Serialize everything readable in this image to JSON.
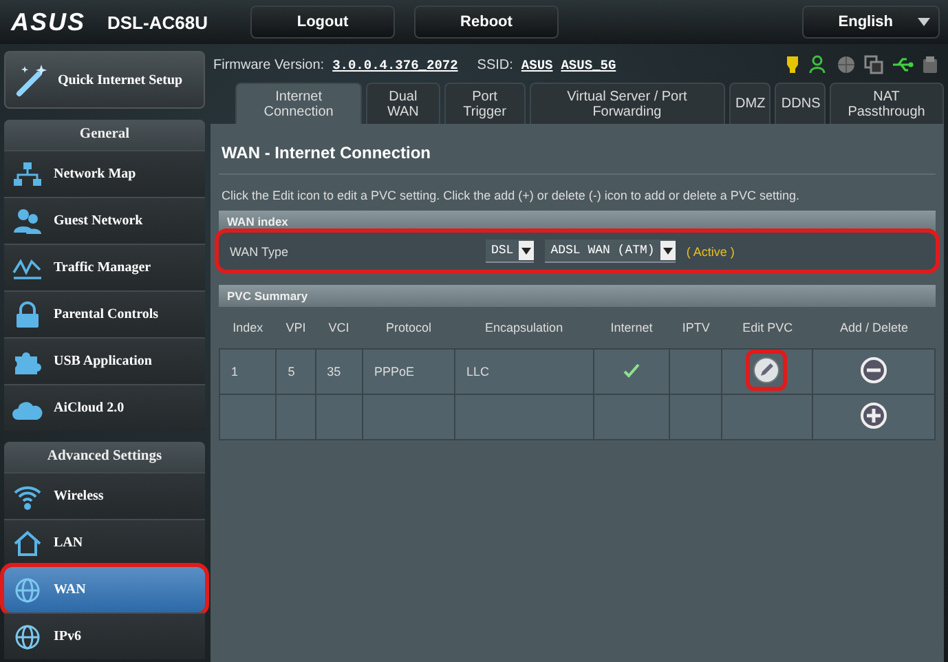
{
  "header": {
    "logo": "ASUS",
    "model": "DSL-AC68U",
    "buttons": [
      "Logout",
      "Reboot"
    ],
    "language": "English"
  },
  "quick_setup": {
    "label": "Quick Internet Setup"
  },
  "sidebar": [
    {
      "title": "General",
      "items": [
        {
          "label": "Network Map",
          "kind": "network",
          "selected": false,
          "highlighted": false
        },
        {
          "label": "Guest Network",
          "kind": "guests",
          "selected": false,
          "highlighted": false
        },
        {
          "label": "Traffic Manager",
          "kind": "traffic",
          "selected": false,
          "highlighted": false
        },
        {
          "label": "Parental Controls",
          "kind": "lock",
          "selected": false,
          "highlighted": false
        },
        {
          "label": "USB Application",
          "kind": "puzzle",
          "selected": false,
          "highlighted": false
        },
        {
          "label": "AiCloud 2.0",
          "kind": "cloud",
          "selected": false,
          "highlighted": false
        }
      ]
    },
    {
      "title": "Advanced Settings",
      "items": [
        {
          "label": "Wireless",
          "kind": "wifi",
          "selected": false,
          "highlighted": false
        },
        {
          "label": "LAN",
          "kind": "home",
          "selected": false,
          "highlighted": false
        },
        {
          "label": "WAN",
          "kind": "globe",
          "selected": true,
          "highlighted": true
        },
        {
          "label": "IPv6",
          "kind": "globe",
          "selected": false,
          "highlighted": false
        }
      ]
    }
  ],
  "info": {
    "firmware_label": "Firmware Version:",
    "firmware": "3.0.0.4.376_2072",
    "ssid_label": "SSID:",
    "ssids": [
      "ASUS",
      "ASUS_5G"
    ]
  },
  "tabs": [
    {
      "label": "Internet Connection",
      "selected": true
    },
    {
      "label": "Dual WAN",
      "selected": false
    },
    {
      "label": "Port Trigger",
      "selected": false
    },
    {
      "label": "Virtual Server / Port Forwarding",
      "selected": false
    },
    {
      "label": "DMZ",
      "selected": false
    },
    {
      "label": "DDNS",
      "selected": false
    },
    {
      "label": "NAT Passthrough",
      "selected": false
    }
  ],
  "page": {
    "title": "WAN - Internet Connection",
    "description": "Click the Edit icon to edit a PVC setting. Click the add (+) or delete (-) icon to add or delete a PVC setting.",
    "wan_index": {
      "header": "WAN index",
      "label": "WAN Type",
      "selects": [
        "DSL",
        "ADSL WAN (ATM)"
      ],
      "status": "( Active )",
      "highlighted": true
    },
    "pvc": {
      "header": "PVC Summary",
      "columns": [
        "Index",
        "VPI",
        "VCI",
        "Protocol",
        "Encapsulation",
        "Internet",
        "IPTV",
        "Edit PVC",
        "Add / Delete"
      ],
      "rows": [
        {
          "kind": "pvc",
          "cells": [
            "1",
            "5",
            "35",
            "PPPoE",
            "LLC"
          ],
          "internet": true,
          "iptv": false,
          "edit_highlighted": true
        },
        {
          "kind": "add"
        }
      ]
    }
  }
}
